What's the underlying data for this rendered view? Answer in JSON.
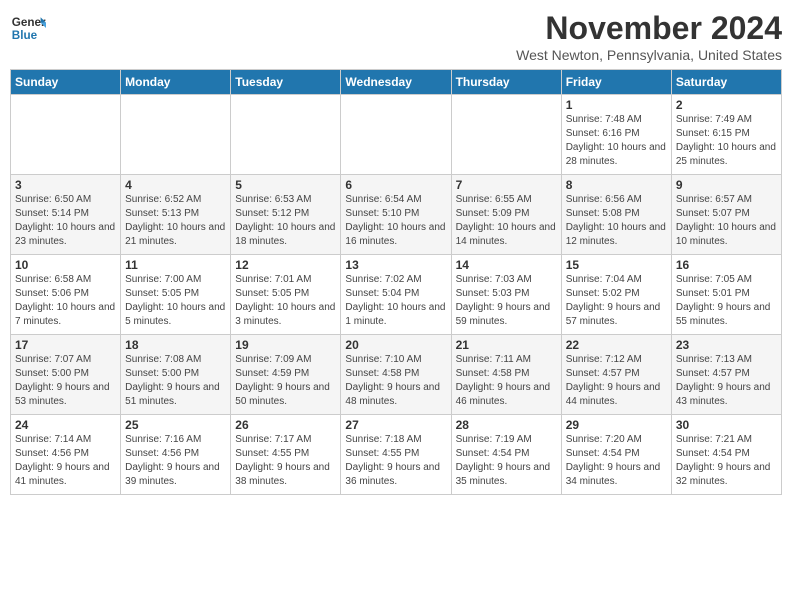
{
  "logo": {
    "line1": "General",
    "line2": "Blue"
  },
  "title": "November 2024",
  "location": "West Newton, Pennsylvania, United States",
  "days_of_week": [
    "Sunday",
    "Monday",
    "Tuesday",
    "Wednesday",
    "Thursday",
    "Friday",
    "Saturday"
  ],
  "weeks": [
    [
      {
        "day": "",
        "info": ""
      },
      {
        "day": "",
        "info": ""
      },
      {
        "day": "",
        "info": ""
      },
      {
        "day": "",
        "info": ""
      },
      {
        "day": "",
        "info": ""
      },
      {
        "day": "1",
        "info": "Sunrise: 7:48 AM\nSunset: 6:16 PM\nDaylight: 10 hours and 28 minutes."
      },
      {
        "day": "2",
        "info": "Sunrise: 7:49 AM\nSunset: 6:15 PM\nDaylight: 10 hours and 25 minutes."
      }
    ],
    [
      {
        "day": "3",
        "info": "Sunrise: 6:50 AM\nSunset: 5:14 PM\nDaylight: 10 hours and 23 minutes."
      },
      {
        "day": "4",
        "info": "Sunrise: 6:52 AM\nSunset: 5:13 PM\nDaylight: 10 hours and 21 minutes."
      },
      {
        "day": "5",
        "info": "Sunrise: 6:53 AM\nSunset: 5:12 PM\nDaylight: 10 hours and 18 minutes."
      },
      {
        "day": "6",
        "info": "Sunrise: 6:54 AM\nSunset: 5:10 PM\nDaylight: 10 hours and 16 minutes."
      },
      {
        "day": "7",
        "info": "Sunrise: 6:55 AM\nSunset: 5:09 PM\nDaylight: 10 hours and 14 minutes."
      },
      {
        "day": "8",
        "info": "Sunrise: 6:56 AM\nSunset: 5:08 PM\nDaylight: 10 hours and 12 minutes."
      },
      {
        "day": "9",
        "info": "Sunrise: 6:57 AM\nSunset: 5:07 PM\nDaylight: 10 hours and 10 minutes."
      }
    ],
    [
      {
        "day": "10",
        "info": "Sunrise: 6:58 AM\nSunset: 5:06 PM\nDaylight: 10 hours and 7 minutes."
      },
      {
        "day": "11",
        "info": "Sunrise: 7:00 AM\nSunset: 5:05 PM\nDaylight: 10 hours and 5 minutes."
      },
      {
        "day": "12",
        "info": "Sunrise: 7:01 AM\nSunset: 5:05 PM\nDaylight: 10 hours and 3 minutes."
      },
      {
        "day": "13",
        "info": "Sunrise: 7:02 AM\nSunset: 5:04 PM\nDaylight: 10 hours and 1 minute."
      },
      {
        "day": "14",
        "info": "Sunrise: 7:03 AM\nSunset: 5:03 PM\nDaylight: 9 hours and 59 minutes."
      },
      {
        "day": "15",
        "info": "Sunrise: 7:04 AM\nSunset: 5:02 PM\nDaylight: 9 hours and 57 minutes."
      },
      {
        "day": "16",
        "info": "Sunrise: 7:05 AM\nSunset: 5:01 PM\nDaylight: 9 hours and 55 minutes."
      }
    ],
    [
      {
        "day": "17",
        "info": "Sunrise: 7:07 AM\nSunset: 5:00 PM\nDaylight: 9 hours and 53 minutes."
      },
      {
        "day": "18",
        "info": "Sunrise: 7:08 AM\nSunset: 5:00 PM\nDaylight: 9 hours and 51 minutes."
      },
      {
        "day": "19",
        "info": "Sunrise: 7:09 AM\nSunset: 4:59 PM\nDaylight: 9 hours and 50 minutes."
      },
      {
        "day": "20",
        "info": "Sunrise: 7:10 AM\nSunset: 4:58 PM\nDaylight: 9 hours and 48 minutes."
      },
      {
        "day": "21",
        "info": "Sunrise: 7:11 AM\nSunset: 4:58 PM\nDaylight: 9 hours and 46 minutes."
      },
      {
        "day": "22",
        "info": "Sunrise: 7:12 AM\nSunset: 4:57 PM\nDaylight: 9 hours and 44 minutes."
      },
      {
        "day": "23",
        "info": "Sunrise: 7:13 AM\nSunset: 4:57 PM\nDaylight: 9 hours and 43 minutes."
      }
    ],
    [
      {
        "day": "24",
        "info": "Sunrise: 7:14 AM\nSunset: 4:56 PM\nDaylight: 9 hours and 41 minutes."
      },
      {
        "day": "25",
        "info": "Sunrise: 7:16 AM\nSunset: 4:56 PM\nDaylight: 9 hours and 39 minutes."
      },
      {
        "day": "26",
        "info": "Sunrise: 7:17 AM\nSunset: 4:55 PM\nDaylight: 9 hours and 38 minutes."
      },
      {
        "day": "27",
        "info": "Sunrise: 7:18 AM\nSunset: 4:55 PM\nDaylight: 9 hours and 36 minutes."
      },
      {
        "day": "28",
        "info": "Sunrise: 7:19 AM\nSunset: 4:54 PM\nDaylight: 9 hours and 35 minutes."
      },
      {
        "day": "29",
        "info": "Sunrise: 7:20 AM\nSunset: 4:54 PM\nDaylight: 9 hours and 34 minutes."
      },
      {
        "day": "30",
        "info": "Sunrise: 7:21 AM\nSunset: 4:54 PM\nDaylight: 9 hours and 32 minutes."
      }
    ]
  ]
}
